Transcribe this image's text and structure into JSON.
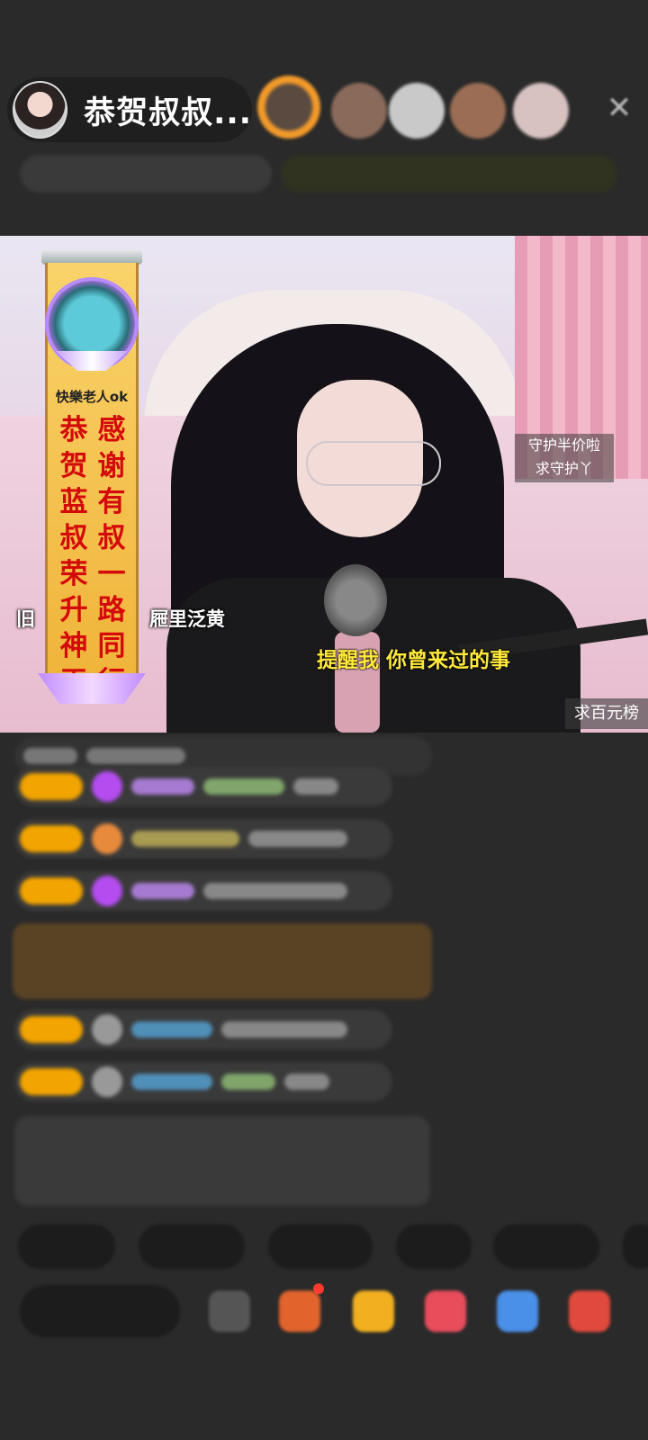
{
  "header": {
    "host_name": "恭贺叔叔...",
    "close_icon": "close-icon"
  },
  "video": {
    "banner": {
      "username": "快樂老人ok",
      "col_right": "感谢有叔一路同行",
      "col_left": "恭贺蓝叔荣升神王"
    },
    "overlay_left": "旧",
    "overlay_right": "屜里泛黄",
    "guard_line1": "守护半价啦",
    "guard_line2": "求守护丫",
    "subtitle": "提醒我  你曾来过的事",
    "rank_text": "求百元榜"
  },
  "colors": {
    "background": "#2a2a2a",
    "banner_gold": "#f0b43a",
    "banner_text_red": "#d40909",
    "subtitle_yellow": "#ffe93a",
    "badge_gold": "#f2a400"
  }
}
